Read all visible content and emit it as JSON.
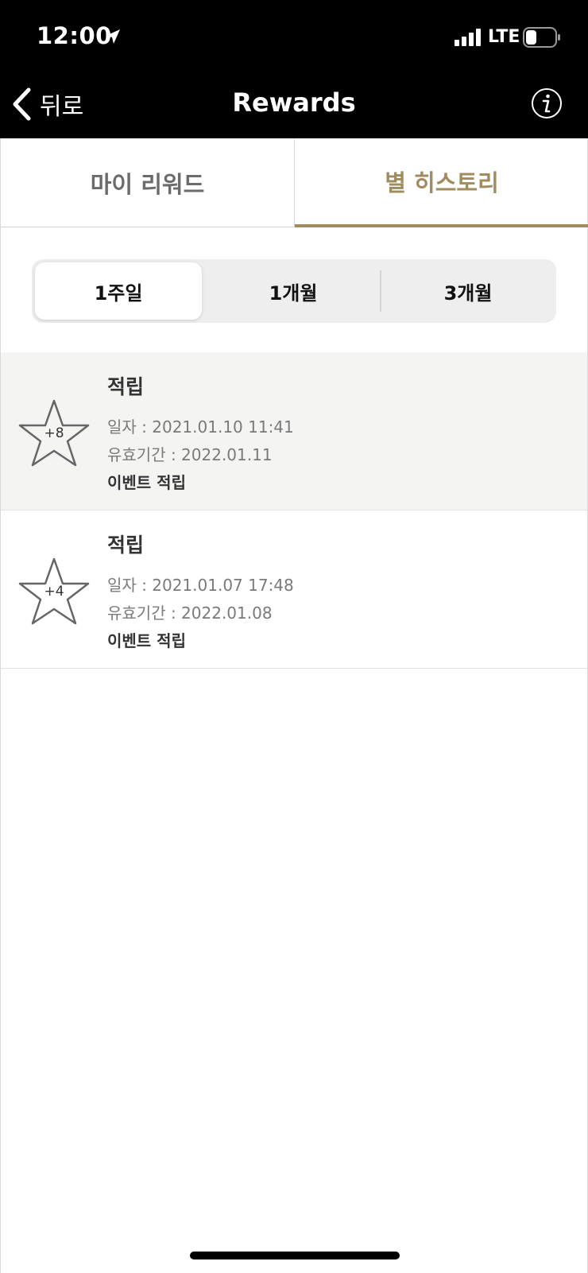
{
  "status_bar": {
    "time": "12:00",
    "network": "LTE",
    "icons": [
      "location-arrow-icon",
      "signal-icon",
      "battery-icon"
    ]
  },
  "nav": {
    "back_label": "뒤로",
    "title": "Rewards",
    "icons": [
      "back-chevron-icon",
      "info-icon"
    ]
  },
  "tabs": [
    {
      "label": "마이 리워드",
      "active": false
    },
    {
      "label": "별 히스토리",
      "active": true
    }
  ],
  "period_filter": {
    "options": [
      "1주일",
      "1개월",
      "3개월"
    ],
    "selected": "1주일"
  },
  "history": [
    {
      "points": "+8",
      "title": "적립",
      "date": "일자 : 2021.01.10 11:41",
      "expiry": "유효기간 : 2022.01.11",
      "description": "이벤트 적립"
    },
    {
      "points": "+4",
      "title": "적립",
      "date": "일자 : 2021.01.07 17:48",
      "expiry": "유효기간 : 2022.01.08",
      "description": "이벤트 적립"
    }
  ],
  "colors": {
    "accent": "#a08c5f",
    "header_bg": "#000000",
    "highlight_row": "#f4f4f3",
    "segment_bg": "#eeeeef"
  }
}
